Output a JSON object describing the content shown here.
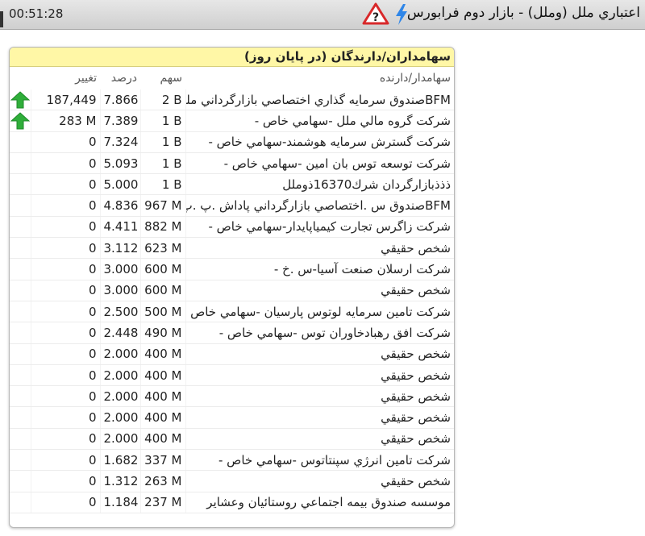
{
  "window": {
    "time": "00:51:28",
    "title": "اعتباري ملل (وملل) - بازار دوم فرابورس"
  },
  "icons": {
    "warning": "warning-question-icon",
    "bolt": "lightning-bolt-icon",
    "trend_up": "green-up-arrow-icon"
  },
  "colors": {
    "header_bg": "#fff7a6",
    "arrow_green": "#2fae3a",
    "warning_red": "#d8282a",
    "bolt_blue": "#2f86e8"
  },
  "panel": {
    "title": "سهامداران/دارندگان (در پايان روز)",
    "columns": {
      "change": "تغيير",
      "percent": "درصد",
      "share": "سهم",
      "holder": "سهامدار/دارنده"
    },
    "rows": [
      {
        "arrow": true,
        "change": "187,449",
        "percent": "7.866",
        "share": "2 B",
        "holder": "BFMصندوق سرمايه گذاري اختصاصي بازارگرداني ملل"
      },
      {
        "arrow": true,
        "change": "283 M",
        "percent": "7.389",
        "share": "1 B",
        "holder": "شركت گروه مالي ملل -سهامي خاص -"
      },
      {
        "arrow": false,
        "change": "0",
        "percent": "7.324",
        "share": "1 B",
        "holder": "شركت گسترش سرمايه هوشمند-سهامي خاص -"
      },
      {
        "arrow": false,
        "change": "0",
        "percent": "5.093",
        "share": "1 B",
        "holder": "شركت توسعه توس بان امين -سهامي خاص -"
      },
      {
        "arrow": false,
        "change": "0",
        "percent": "5.000",
        "share": "1 B",
        "holder": "ذذذبازارگردان شرك16370ذوملل"
      },
      {
        "arrow": false,
        "change": "0",
        "percent": "4.836",
        "share": "967 M",
        "holder": "BFMصندوق س .اختصاصي بازارگرداني پاداش .پ .پ"
      },
      {
        "arrow": false,
        "change": "0",
        "percent": "4.411",
        "share": "882 M",
        "holder": "شركت زاگرس تجارت كيمياپايدار-سهامي خاص -"
      },
      {
        "arrow": false,
        "change": "0",
        "percent": "3.112",
        "share": "623 M",
        "holder": "شخص حقيقي"
      },
      {
        "arrow": false,
        "change": "0",
        "percent": "3.000",
        "share": "600 M",
        "holder": "شركت ارسلان صنعت آسيا-س .خ -"
      },
      {
        "arrow": false,
        "change": "0",
        "percent": "3.000",
        "share": "600 M",
        "holder": "شخص حقيقي"
      },
      {
        "arrow": false,
        "change": "0",
        "percent": "2.500",
        "share": "500 M",
        "holder": "شركت تامين سرمايه لوتوس پارسيان -سهامي خاص -"
      },
      {
        "arrow": false,
        "change": "0",
        "percent": "2.448",
        "share": "490 M",
        "holder": "شركت افق رهبادخاوران توس -سهامي خاص -"
      },
      {
        "arrow": false,
        "change": "0",
        "percent": "2.000",
        "share": "400 M",
        "holder": "شخص حقيقي"
      },
      {
        "arrow": false,
        "change": "0",
        "percent": "2.000",
        "share": "400 M",
        "holder": "شخص حقيقي"
      },
      {
        "arrow": false,
        "change": "0",
        "percent": "2.000",
        "share": "400 M",
        "holder": "شخص حقيقي"
      },
      {
        "arrow": false,
        "change": "0",
        "percent": "2.000",
        "share": "400 M",
        "holder": "شخص حقيقي"
      },
      {
        "arrow": false,
        "change": "0",
        "percent": "2.000",
        "share": "400 M",
        "holder": "شخص حقيقي"
      },
      {
        "arrow": false,
        "change": "0",
        "percent": "1.682",
        "share": "337 M",
        "holder": "شركت تامين انرژي سپنتاتوس -سهامي خاص -"
      },
      {
        "arrow": false,
        "change": "0",
        "percent": "1.312",
        "share": "263 M",
        "holder": "شخص حقيقي"
      },
      {
        "arrow": false,
        "change": "0",
        "percent": "1.184",
        "share": "237 M",
        "holder": "موسسه صندوق بيمه اجتماعي روستائيان وعشاير"
      }
    ]
  }
}
